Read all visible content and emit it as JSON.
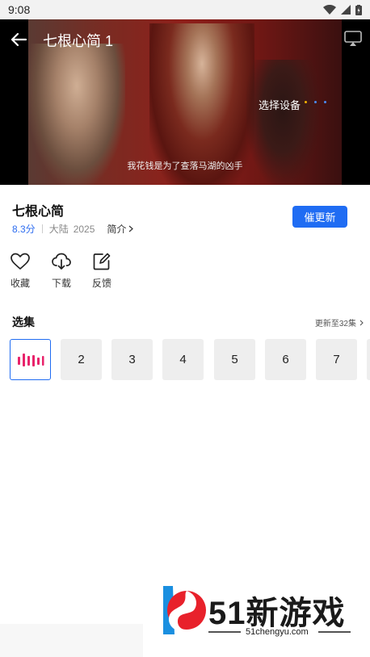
{
  "status_bar": {
    "time": "9:08"
  },
  "player": {
    "title": "七根心简 1",
    "device_label": "选择设备",
    "subtitle": "我花钱是为了查落马湖的凶手",
    "dot_colors": [
      "#f5b400",
      "#4a8df6",
      "#4a8df6"
    ]
  },
  "show": {
    "title": "七根心简",
    "score": "8.3分",
    "region": "大陆",
    "year": "2025",
    "intro_label": "简介",
    "urge_button": "催更新"
  },
  "actions": [
    {
      "label": "收藏",
      "icon": "heart-icon"
    },
    {
      "label": "下载",
      "icon": "download-cloud-icon"
    },
    {
      "label": "反馈",
      "icon": "edit-feedback-icon"
    }
  ],
  "episodes": {
    "title": "选集",
    "more_label": "更新至32集",
    "items": [
      "2",
      "3",
      "4",
      "5",
      "6",
      "7"
    ],
    "accent_color": "#e8236b"
  },
  "watermark": {
    "text": "51新游戏",
    "domain": "51chengyu.com"
  },
  "colors": {
    "primary": "#1f6cf3",
    "score": "#2f6ef0"
  }
}
